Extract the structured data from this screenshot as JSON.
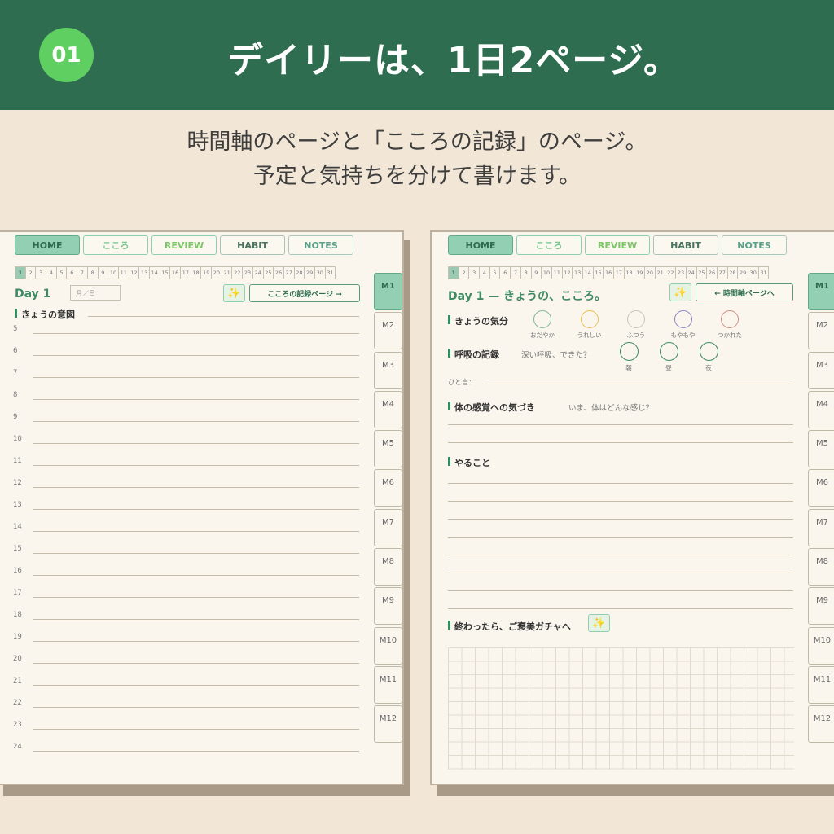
{
  "banner": {
    "badge": "01",
    "title": "デイリーは、1日2ページ。",
    "bg_color": "#2e6d4f",
    "badge_color": "#5fcf62"
  },
  "subtitle": {
    "line1": "時間軸のページと「こころの記録」のページ。",
    "line2": "予定と気持ちを分けて書けます。"
  },
  "tabs": [
    "HOME",
    "こころ",
    "REVIEW",
    "HABIT",
    "NOTES"
  ],
  "days": [
    "1",
    "2",
    "3",
    "4",
    "5",
    "6",
    "7",
    "8",
    "9",
    "10",
    "11",
    "12",
    "13",
    "14",
    "15",
    "16",
    "17",
    "18",
    "19",
    "20",
    "21",
    "22",
    "23",
    "24",
    "25",
    "26",
    "27",
    "28",
    "29",
    "30",
    "31"
  ],
  "months": [
    "M1",
    "M2",
    "M3",
    "M4",
    "M5",
    "M6",
    "M7",
    "M8",
    "M9",
    "M10",
    "M11",
    "M12"
  ],
  "left_page": {
    "day_title": "Day 1",
    "date_placeholder": "月／日",
    "wand_icon": "magic-wand-icon",
    "nav_button": "こころの記録ページ →",
    "intention_label": "きょうの意図",
    "hours": [
      "5",
      "6",
      "7",
      "8",
      "9",
      "10",
      "11",
      "12",
      "13",
      "14",
      "15",
      "16",
      "17",
      "18",
      "19",
      "20",
      "21",
      "22",
      "23",
      "24"
    ]
  },
  "right_page": {
    "day_title": "Day 1 — きょうの、こころ。",
    "nav_button": "← 時間軸ページへ",
    "mood_label": "きょうの気分",
    "moods": [
      {
        "label": "おだやか",
        "color": "#7cb89a"
      },
      {
        "label": "うれしい",
        "color": "#e8c24f"
      },
      {
        "label": "ふつう",
        "color": "#c9c3b3"
      },
      {
        "label": "もやもや",
        "color": "#8f86c4"
      },
      {
        "label": "つかれた",
        "color": "#d98b86"
      }
    ],
    "breath_label": "呼吸の記録",
    "breath_hint": "深い呼吸、できた？",
    "breath_times": [
      {
        "label": "朝",
        "color": "#3e8a63"
      },
      {
        "label": "昼",
        "color": "#3e8a63"
      },
      {
        "label": "夜",
        "color": "#3e8a63"
      }
    ],
    "hitokoto_label": "ひと言：",
    "body_label": "体の感覚への気づき",
    "body_hint": "いま、体はどんな感じ？",
    "todo_label": "やること",
    "gacha_label": "終わったら、ご褒美ガチャへ"
  }
}
